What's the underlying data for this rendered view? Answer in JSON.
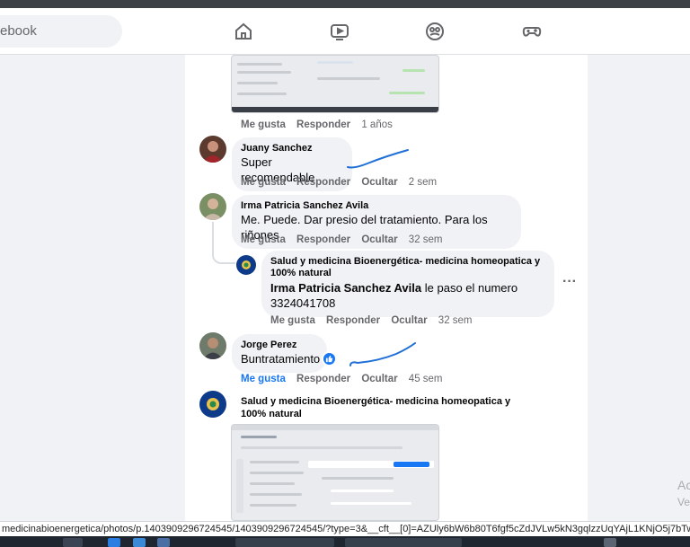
{
  "header": {
    "search_placeholder": "ebook",
    "nav": [
      "home-icon",
      "video-icon",
      "groups-icon",
      "gaming-icon"
    ]
  },
  "comments": [
    {
      "id": "first",
      "actions": {
        "like": "Me gusta",
        "reply": "Responder",
        "time": "1 años"
      }
    },
    {
      "id": "juany",
      "author": "Juany Sanchez",
      "text": "Super recomendable",
      "actions": {
        "like": "Me gusta",
        "reply": "Responder",
        "hide": "Ocultar",
        "time": "2 sem"
      }
    },
    {
      "id": "irma",
      "author": "Irma Patricia Sanchez Avila",
      "text": "Me. Puede. Dar presio del tratamiento. Para los riñones",
      "actions": {
        "like": "Me gusta",
        "reply": "Responder",
        "hide": "Ocultar",
        "time": "32 sem"
      }
    },
    {
      "id": "salud-reply",
      "author": "Salud y medicina Bioenergética- medicina homeopatica y 100% natural",
      "mention": "Irma Patricia Sanchez Avila",
      "text": "le paso el numero",
      "phone": "3324041708",
      "more": "···",
      "actions": {
        "like": "Me gusta",
        "reply": "Responder",
        "hide": "Ocultar",
        "time": "32 sem"
      }
    },
    {
      "id": "jorge",
      "author": "Jorge Perez",
      "text": "Buntratamiento",
      "actions": {
        "like": "Me gusta",
        "reply": "Responder",
        "hide": "Ocultar",
        "time": "45 sem"
      },
      "liked": true
    }
  ],
  "post": {
    "author": "Salud y medicina Bioenergética- medicina homeopatica y 100% natural"
  },
  "watermark": {
    "line1": "Ac",
    "line2": "Ve"
  },
  "status_url": "medicinabioenergetica/photos/p.1403909296724545/1403909296724545/?type=3&__cft__[0]=AZUly6bW6b80T6fgf5cZdJVLw5kN3gqlzzUqYAjL1KNjO5j7bTw4S8Bs-U",
  "colors": {
    "accent": "#1877f2",
    "scribble": "#1f6fd6"
  }
}
